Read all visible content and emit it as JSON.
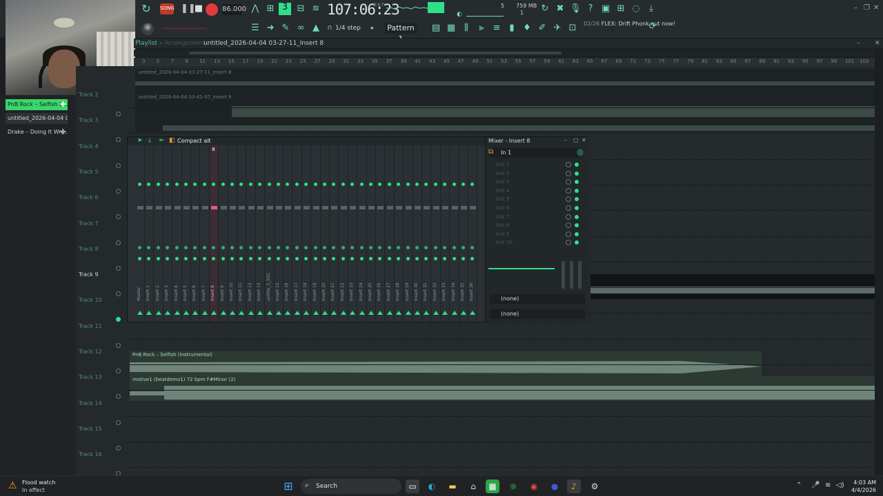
{
  "toolbar": {
    "tempo": "86.000",
    "time": "107:06",
    "time_ticks": "23",
    "time_unit": "B:S:T",
    "memory": "759 MB",
    "voices": "5",
    "cpu": "1",
    "snap": "1/4 step",
    "pattern": "Pattern 1",
    "news_count": "02/26",
    "news_text": "FLEX: Drift Phonk out now!"
  },
  "browser": {
    "items": [
      {
        "label": "PnB Rock – Selfish (I...",
        "state": "active"
      },
      {
        "label": "untitled_2026-04-04 03-...",
        "state": "selected"
      },
      {
        "label": "Drake – Doing It Wro...",
        "state": "normal"
      }
    ]
  },
  "playlist": {
    "title": "Playlist",
    "subtitle": "Arrangement",
    "pattern_label": "untitled_2026-04-04 03-27-11_Insert 8",
    "ruler_ticks": [
      "3",
      "5",
      "7",
      "9",
      "11",
      "13",
      "15",
      "17",
      "19",
      "21",
      "23",
      "25",
      "27",
      "29",
      "31",
      "33",
      "35",
      "37",
      "39",
      "41",
      "43",
      "45",
      "47",
      "49",
      "51",
      "53",
      "55",
      "57",
      "59",
      "61",
      "63",
      "65",
      "67",
      "69",
      "71",
      "73",
      "75",
      "77",
      "79",
      "81",
      "83",
      "85",
      "87",
      "89",
      "91",
      "93",
      "95",
      "97",
      "99",
      "101",
      "103"
    ],
    "tracks": [
      {
        "label": "Track 2"
      },
      {
        "label": "Track 3"
      },
      {
        "label": "Track 4"
      },
      {
        "label": "Track 5"
      },
      {
        "label": "Track 6"
      },
      {
        "label": "Track 7"
      },
      {
        "label": "Track 8"
      },
      {
        "label": "Track 9"
      },
      {
        "label": "Track 10"
      },
      {
        "label": "Track 11"
      },
      {
        "label": "Track 12"
      },
      {
        "label": "Track 13"
      },
      {
        "label": "Track 14"
      },
      {
        "label": "Track 15"
      },
      {
        "label": "Track 16"
      }
    ],
    "clips": [
      {
        "label": "untitled_2026-04-04 03-27-11_Insert 8"
      },
      {
        "label": "untitled_2026-04-04 03-41-07_Insert 8"
      },
      {
        "label": "PnB Rock – Selfish (Instrumental)"
      },
      {
        "label": "motive1 (beatdemo1) 72 bpm F#Minor (2)"
      }
    ]
  },
  "mixer": {
    "mode": "Compact alt",
    "title": "Mixer - Insert 8",
    "input": "In 1",
    "strips": [
      "Master",
      "Insert 1",
      "Insert 2",
      "Insert 3",
      "Insert 4",
      "Insert 5",
      "Insert 6",
      "Insert 7",
      "Insert 8",
      "Insert 9",
      "Insert 10",
      "Insert 11",
      "Insert 12",
      "Insert 13",
      "untitle_3_REC",
      "Insert 15",
      "Insert 16",
      "Insert 17",
      "Insert 18",
      "Insert 19",
      "Insert 20",
      "Insert 21",
      "Insert 22",
      "Insert 23",
      "Insert 24",
      "Insert 25",
      "Insert 26",
      "Insert 27",
      "Insert 28",
      "Insert 29",
      "Insert 30",
      "Insert 31",
      "Insert 32",
      "Insert 33",
      "Insert 34",
      "Insert 35",
      "Insert 36"
    ],
    "selected_index": 8,
    "selected_number": "8",
    "slots": [
      "Slot 1",
      "Slot 2",
      "Slot 3",
      "Slot 4",
      "Slot 5",
      "Slot 6",
      "Slot 7",
      "Slot 8",
      "Slot 9",
      "Slot 10"
    ],
    "eq_none": "(none)",
    "out_none": "(none)"
  },
  "taskbar": {
    "weather_title": "Flood watch",
    "weather_status": "In effect",
    "search_label": "Search",
    "time": "4:03 AM",
    "date": "4/4/2026"
  },
  "colors": {
    "accent": "#2fe08a",
    "active_item": "#3ad66c",
    "selected_strip": "#e3a3b8"
  }
}
